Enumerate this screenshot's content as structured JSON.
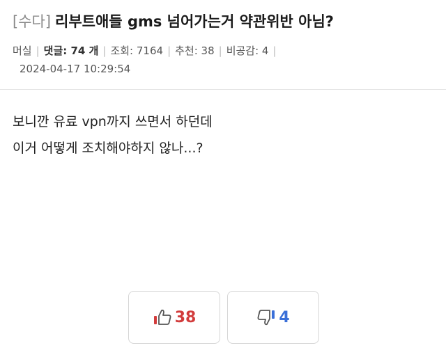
{
  "post": {
    "category": "[수다]",
    "title": "리부트애들 gms 넘어가는거 약관위반 아님?",
    "author": "머실",
    "comments_label": "댓글: 74 개",
    "views_label": "조회: 7164",
    "recommend_label": "추천: 38",
    "dislike_label": "비공감: 4",
    "separator": "|",
    "date": "2024-04-17 10:29:54"
  },
  "content": {
    "lines": [
      "보니깐 유료 vpn까지 쓰면서 하던데",
      "이거 어떻게 조치해야하지 않나...?"
    ]
  },
  "votes": {
    "up_count": "38",
    "down_count": "4",
    "up_icon": "thumbs-up-icon",
    "down_icon": "thumbs-down-icon",
    "up_color": "#d23c3c",
    "down_color": "#3a6fd8"
  }
}
